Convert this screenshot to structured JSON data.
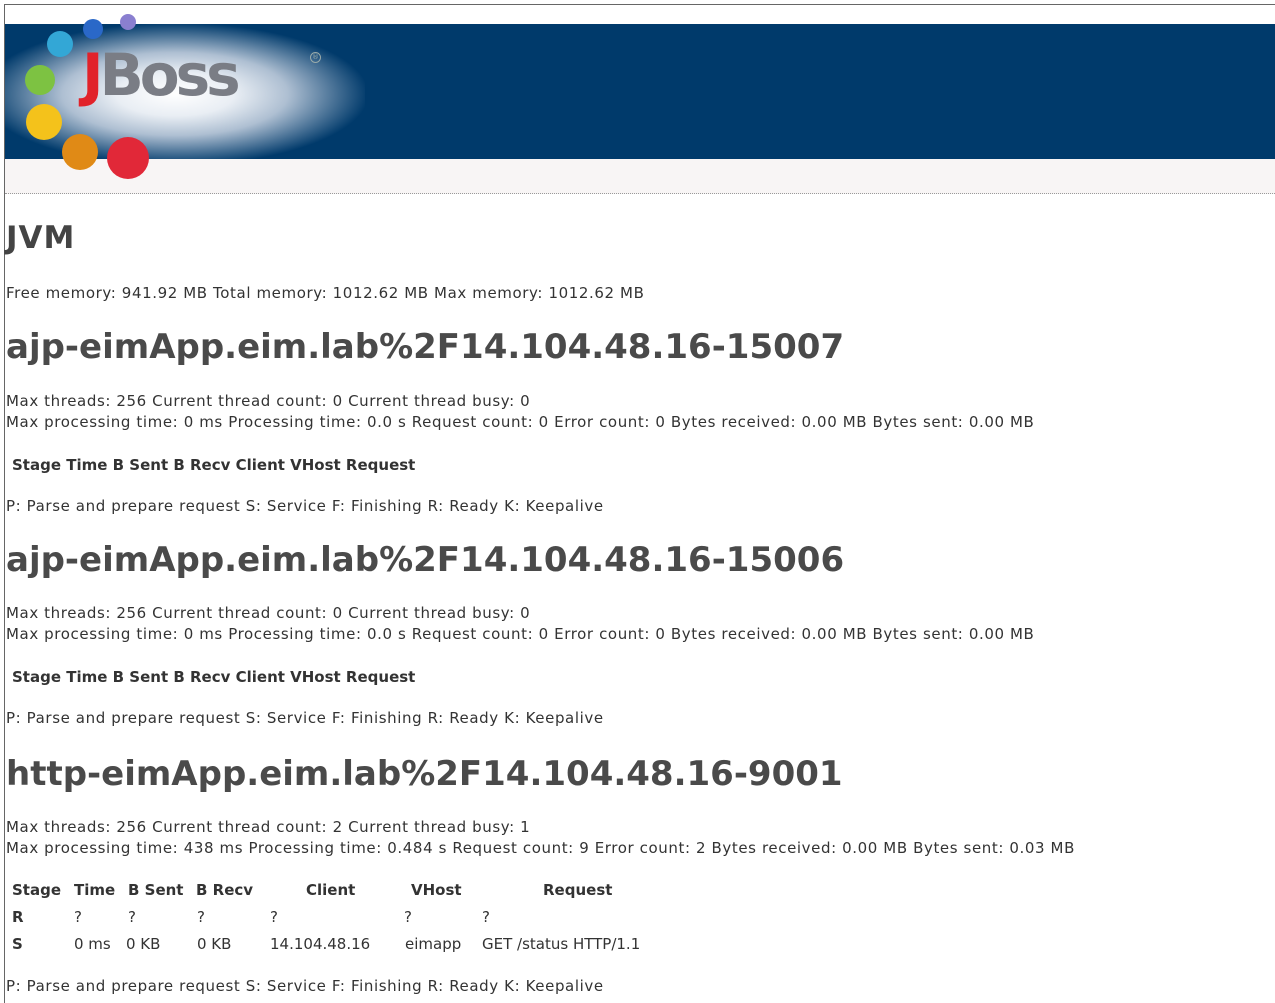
{
  "logo": {
    "text_j": "J",
    "text_rest": "Boss",
    "reg": "®"
  },
  "jvm": {
    "title": "JVM",
    "memory": "Free memory: 941.92 MB Total memory: 1012.62 MB Max memory: 1012.62 MB"
  },
  "connectors": [
    {
      "name": "ajp-eimApp.eim.lab%2F14.104.48.16-15007",
      "threads": "Max threads: 256 Current thread count: 0 Current thread busy: 0",
      "processing": "Max processing time: 0 ms Processing time: 0.0 s Request count: 0 Error count: 0 Bytes received: 0.00 MB Bytes sent: 0.00 MB",
      "table_header": "Stage Time B Sent B Recv Client VHost Request",
      "legend": "P: Parse and prepare request S: Service F: Finishing R: Ready K: Keepalive"
    },
    {
      "name": "ajp-eimApp.eim.lab%2F14.104.48.16-15006",
      "threads": "Max threads: 256 Current thread count: 0 Current thread busy: 0",
      "processing": "Max processing time: 0 ms Processing time: 0.0 s Request count: 0 Error count: 0 Bytes received: 0.00 MB Bytes sent: 0.00 MB",
      "table_header": "Stage Time B Sent B Recv Client VHost Request",
      "legend": "P: Parse and prepare request S: Service F: Finishing R: Ready K: Keepalive"
    },
    {
      "name": "http-eimApp.eim.lab%2F14.104.48.16-9001",
      "threads": "Max threads: 256 Current thread count: 2 Current thread busy: 1",
      "processing": "Max processing time: 438 ms Processing time: 0.484 s Request count: 9 Error count: 2 Bytes received: 0.00 MB Bytes sent: 0.03 MB",
      "columns": [
        "Stage",
        "Time",
        "B Sent",
        "B Recv",
        "Client",
        "VHost",
        "Request"
      ],
      "rows": [
        [
          "R",
          "?",
          "?",
          "?",
          "?",
          "?",
          "?"
        ],
        [
          "S",
          "0 ms",
          "0 KB",
          "0 KB",
          "14.104.48.16",
          "eimapp",
          "GET /status HTTP/1.1"
        ]
      ],
      "legend": "P: Parse and prepare request S: Service F: Finishing R: Ready K: Keepalive"
    }
  ],
  "colors": {
    "banner": "#003a6b",
    "logo_red": "#e1222a",
    "logo_gray": "#7a7d85",
    "dots": [
      "#8a7fd0",
      "#2a68c8",
      "#33a7d6",
      "#7dc242",
      "#f4c21b",
      "#e08a16",
      "#e12838"
    ]
  }
}
